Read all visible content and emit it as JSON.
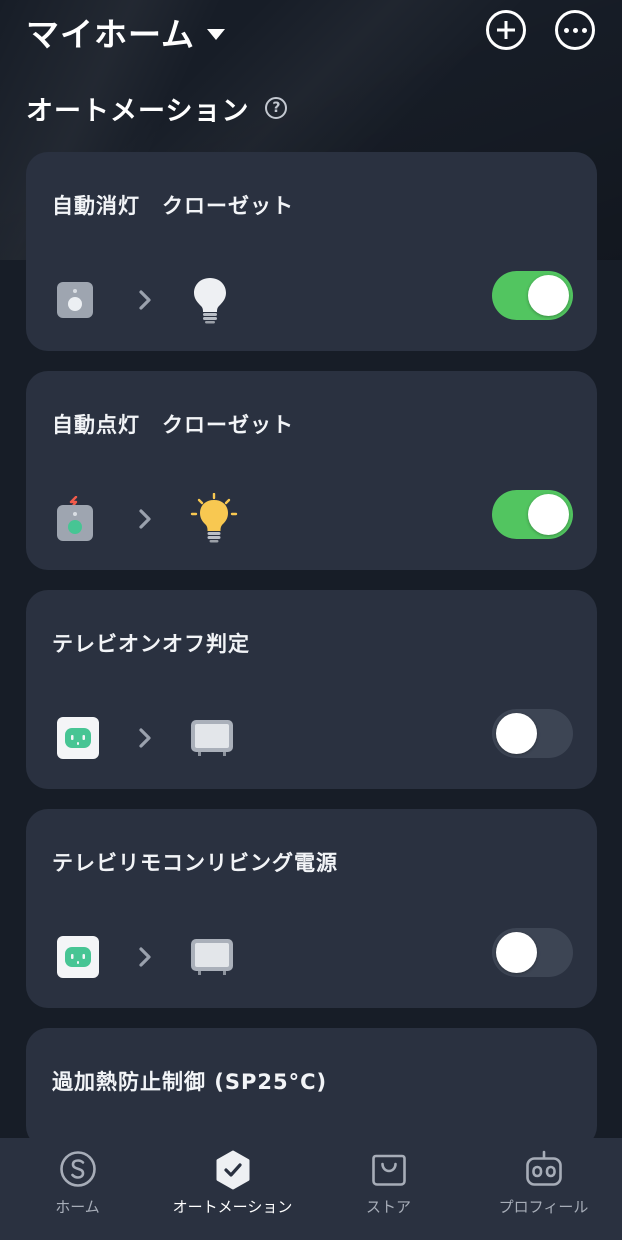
{
  "header": {
    "home_title": "マイホーム",
    "add_icon": "plus-circle-icon",
    "more_icon": "ellipsis-circle-icon"
  },
  "section": {
    "title": "オートメーション",
    "help_glyph": "?"
  },
  "automations": [
    {
      "title": "自動消灯　クローゼット",
      "trigger_icon": "motion-sensor-icon",
      "action_icon": "light-bulb-off-icon",
      "enabled": true
    },
    {
      "title": "自動点灯　クローゼット",
      "trigger_icon": "motion-sensor-active-icon",
      "action_icon": "light-bulb-on-icon",
      "enabled": true
    },
    {
      "title": "テレビオンオフ判定",
      "trigger_icon": "smart-plug-icon",
      "action_icon": "tv-icon",
      "enabled": false
    },
    {
      "title": "テレビリモコンリビング電源",
      "trigger_icon": "smart-plug-icon",
      "action_icon": "tv-icon",
      "enabled": false
    },
    {
      "title": "過加熱防止制御 (SP25°C)",
      "trigger_icon": "",
      "action_icon": "",
      "enabled": null
    }
  ],
  "tabs": [
    {
      "label": "ホーム",
      "icon": "home-s-icon",
      "active": false
    },
    {
      "label": "オートメーション",
      "icon": "automation-check-icon",
      "active": true
    },
    {
      "label": "ストア",
      "icon": "store-bag-icon",
      "active": false
    },
    {
      "label": "プロフィール",
      "icon": "robot-profile-icon",
      "active": false
    }
  ],
  "colors": {
    "background": "#171d27",
    "card": "#2a3140",
    "toggle_on": "#52c560",
    "toggle_off": "#3d4554",
    "bulb_on": "#f8c851",
    "plug_accent": "#47c594"
  }
}
